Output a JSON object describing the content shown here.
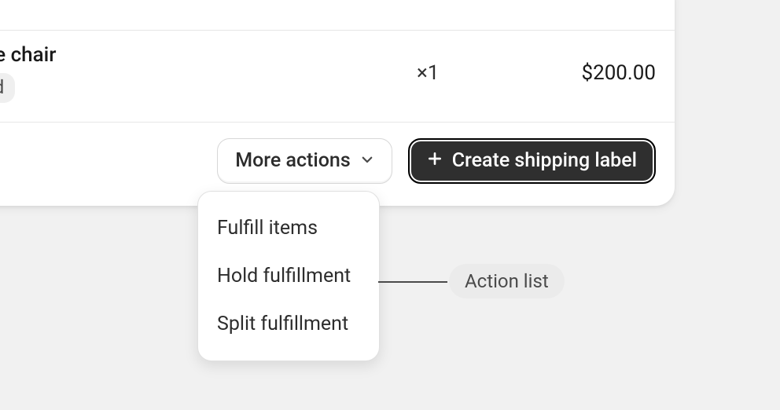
{
  "line_item": {
    "title": "nge chair",
    "variant": "od",
    "qty_label": "×1",
    "price": "$200.00"
  },
  "actions": {
    "more_label": "More actions",
    "primary_label": "Create shipping label"
  },
  "dropdown": {
    "items": [
      {
        "label": "Fulfill items"
      },
      {
        "label": "Hold fulfillment"
      },
      {
        "label": "Split fulfillment"
      }
    ]
  },
  "callout": {
    "label": "Action list"
  }
}
